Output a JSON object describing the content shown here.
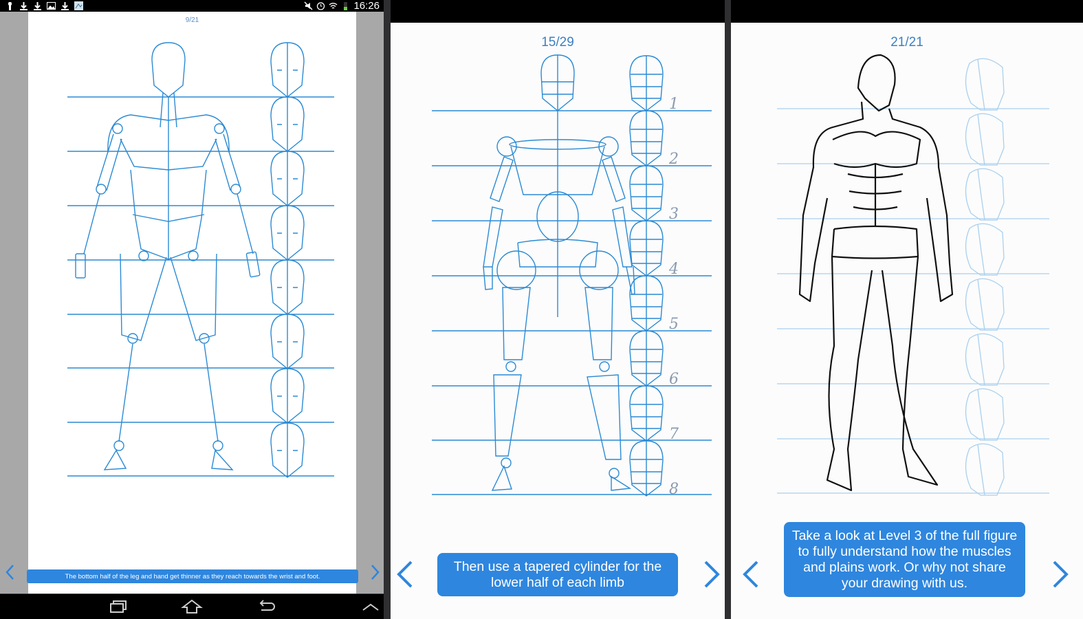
{
  "colors": {
    "accent": "#2e86de",
    "counter_text": "#3d7fc1",
    "sketch_line": "#2a8ad4",
    "faint_sketch": "#a9d0ee",
    "ink": "#111111",
    "sidebar_gray": "#a8a8a8"
  },
  "status_bar": {
    "left_icons": [
      "usb-icon",
      "download-icon",
      "download-icon",
      "image-icon",
      "download-icon",
      "app-thumbnail-icon"
    ],
    "right_icons": [
      "mute-icon",
      "alarm-icon",
      "wifi-icon",
      "battery-icon"
    ],
    "time": "16:26"
  },
  "nav_bar": {
    "buttons": [
      "recent-apps",
      "home",
      "back",
      "menu-up"
    ]
  },
  "panels": [
    {
      "page_counter": "9/21",
      "caption": "The bottom half of the leg and hand get thinner as they reach towards the wrist and foot.",
      "prev_label": "<",
      "next_label": ">",
      "head_units": 8
    },
    {
      "page_counter": "15/29",
      "caption": "Then use a tapered cylinder for the lower half of each limb",
      "prev_label": "<",
      "next_label": ">",
      "head_numbers": [
        "1",
        "2",
        "3",
        "4",
        "5",
        "6",
        "7",
        "8"
      ]
    },
    {
      "page_counter": "21/21",
      "caption": "Take a look at Level 3 of the full figure to fully understand how the muscles and plains work. Or why not share your drawing with us.",
      "prev_label": "<",
      "next_label": ">",
      "head_units": 8
    }
  ]
}
